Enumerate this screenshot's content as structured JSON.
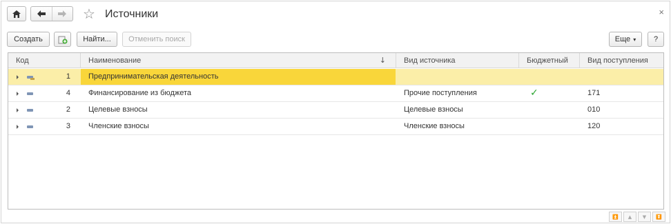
{
  "window": {
    "title": "Источники",
    "close_glyph": "×"
  },
  "nav": {
    "home_icon": "home-icon",
    "back_icon": "arrow-left-icon",
    "forward_icon": "arrow-right-icon",
    "favorite_glyph": "☆"
  },
  "toolbar": {
    "create_label": "Создать",
    "find_label": "Найти...",
    "cancel_search_label": "Отменить поиск",
    "more_label": "Еще",
    "more_arrow": "▾",
    "help_label": "?"
  },
  "table": {
    "columns": [
      "Код",
      "Наименование",
      "Вид источника",
      "Бюджетный",
      "Вид поступления"
    ],
    "sort_indicator": "↓",
    "rows": [
      {
        "code": "1",
        "name": "Предпринимательская деятельность",
        "source_type": "",
        "budget": "",
        "income_type": "",
        "selected": true,
        "folder": true
      },
      {
        "code": "4",
        "name": "Финансирование из бюджета",
        "source_type": "Прочие поступления",
        "budget": "✓",
        "income_type": "171",
        "selected": false,
        "folder": false
      },
      {
        "code": "2",
        "name": "Целевые взносы",
        "source_type": "Целевые взносы",
        "budget": "",
        "income_type": "010",
        "selected": false,
        "folder": false
      },
      {
        "code": "3",
        "name": "Членские взносы",
        "source_type": "Членские взносы",
        "budget": "",
        "income_type": "120",
        "selected": false,
        "folder": false
      }
    ]
  },
  "scroll_nav": [
    "⏫",
    "▲",
    "▼",
    "⏬"
  ]
}
